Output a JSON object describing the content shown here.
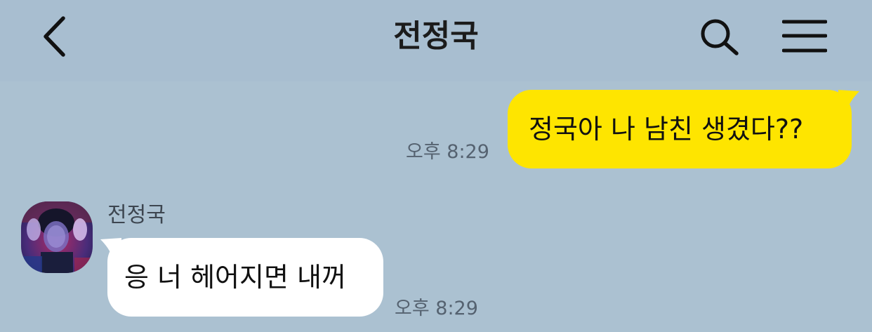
{
  "header": {
    "title": "전정국",
    "back_icon": "chevron-left-icon",
    "search_icon": "search-icon",
    "menu_icon": "hamburger-menu-icon"
  },
  "colors": {
    "header_bg": "#a8bed0",
    "chat_bg": "#abc1d1",
    "my_bubble": "#fee500",
    "friend_bubble": "#ffffff"
  },
  "messages": [
    {
      "sender": "me",
      "text": "정국아 나 남친 생겼다??",
      "time": "오후 8:29"
    },
    {
      "sender": "friend",
      "name": "전정국",
      "text": "응 너 헤어지면 내꺼",
      "time": "오후 8:29",
      "avatar": "profile-photo"
    }
  ]
}
